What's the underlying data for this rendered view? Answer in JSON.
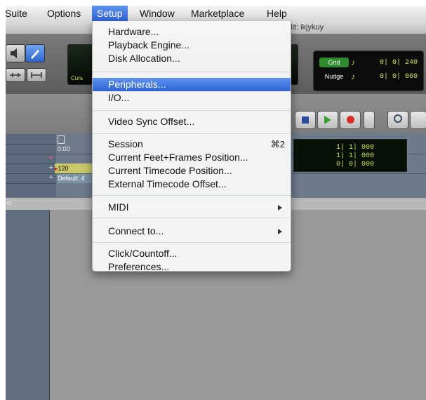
{
  "menubar": {
    "items": [
      {
        "label": "Suite"
      },
      {
        "label": "Options"
      },
      {
        "label": "Setup"
      },
      {
        "label": "Window"
      },
      {
        "label": "Marketplace"
      },
      {
        "label": "Help"
      }
    ]
  },
  "window": {
    "title": "Edit: ikjykuy"
  },
  "grid_panel": {
    "grid_label": "Grid",
    "grid_value": "0| 0| 240",
    "nudge_label": "Nudge",
    "nudge_value": "0| 0| 060"
  },
  "counter_label": "Curs",
  "ruler": {
    "time": "0:00",
    "tempo": "120",
    "meter": "Default: 4"
  },
  "mini_counter": [
    "1| 1| 000",
    "1| 1| 000",
    "0| 0| 000"
  ],
  "track_label": "o",
  "setup_menu": {
    "items": {
      "hardware": "Hardware...",
      "playback_engine": "Playback Engine...",
      "disk_allocation": "Disk Allocation...",
      "peripherals": "Peripherals...",
      "io": "I/O...",
      "video_sync_offset": "Video Sync Offset...",
      "session": "Session",
      "session_shortcut": "⌘2",
      "current_feet_frames": "Current Feet+Frames Position...",
      "current_timecode": "Current Timecode Position...",
      "external_timecode": "External Timecode Offset...",
      "midi": "MIDI",
      "connect_to": "Connect to...",
      "click_countoff": "Click/Countoff...",
      "preferences": "Preferences..."
    },
    "highlighted": "Peripherals..."
  },
  "colors": {
    "menu_highlight": "#3a72e0",
    "counter_text": "#cde858",
    "play_green": "#2fa52f",
    "record_red": "#d42a2a"
  }
}
